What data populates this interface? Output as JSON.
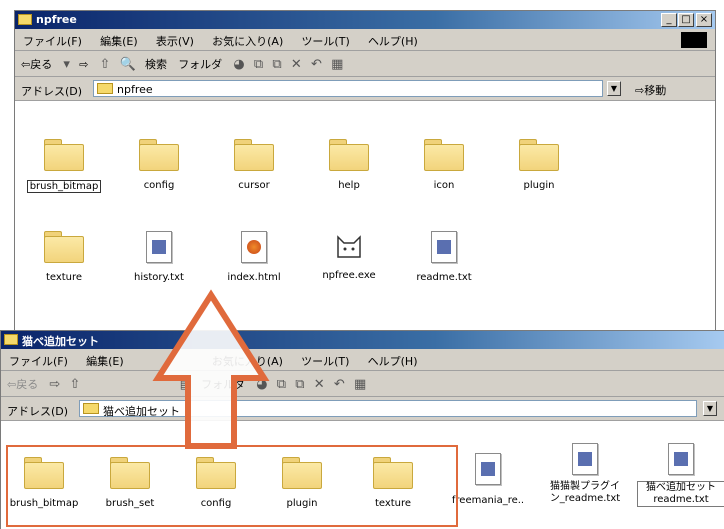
{
  "top_window": {
    "title": "npfree",
    "controls": [
      "_",
      "□",
      "×"
    ],
    "menu": [
      "ファイル(F)",
      "編集(E)",
      "表示(V)",
      "お気に入り(A)",
      "ツール(T)",
      "ヘルプ(H)"
    ],
    "toolbar": {
      "back": "⇦戻る",
      "forward": "⇨",
      "search": "検索",
      "folders": "フォルダ"
    },
    "address_label": "アドレス(D)",
    "address_value": "npfree",
    "go_label": "移動",
    "items_row1": [
      "brush_bitmap",
      "config",
      "cursor",
      "help",
      "icon",
      "plugin"
    ],
    "items_row2": [
      "texture",
      "history.txt",
      "index.html",
      "npfree.exe",
      "readme.txt"
    ]
  },
  "bottom_window": {
    "title": "猫べ追加セット",
    "menu": [
      "ファイル(F)",
      "編集(E)",
      "お気に入り(A)",
      "ツール(T)",
      "ヘルプ(H)"
    ],
    "toolbar": {
      "back": "⇦戻る",
      "folders": "フォルダ"
    },
    "address_label": "アドレス(D)",
    "address_value": "猫べ追加セット",
    "items": [
      "brush_bitmap",
      "brush_set",
      "config",
      "plugin",
      "texture",
      "freemania_re..",
      "猫猫製プラグイ\nン_readme.txt",
      "猫べ追加セット\nreadme.txt"
    ]
  },
  "colors": {
    "title_start": "#0a246a",
    "arrow": "#e06a3c",
    "folder": "#f2d47c"
  }
}
